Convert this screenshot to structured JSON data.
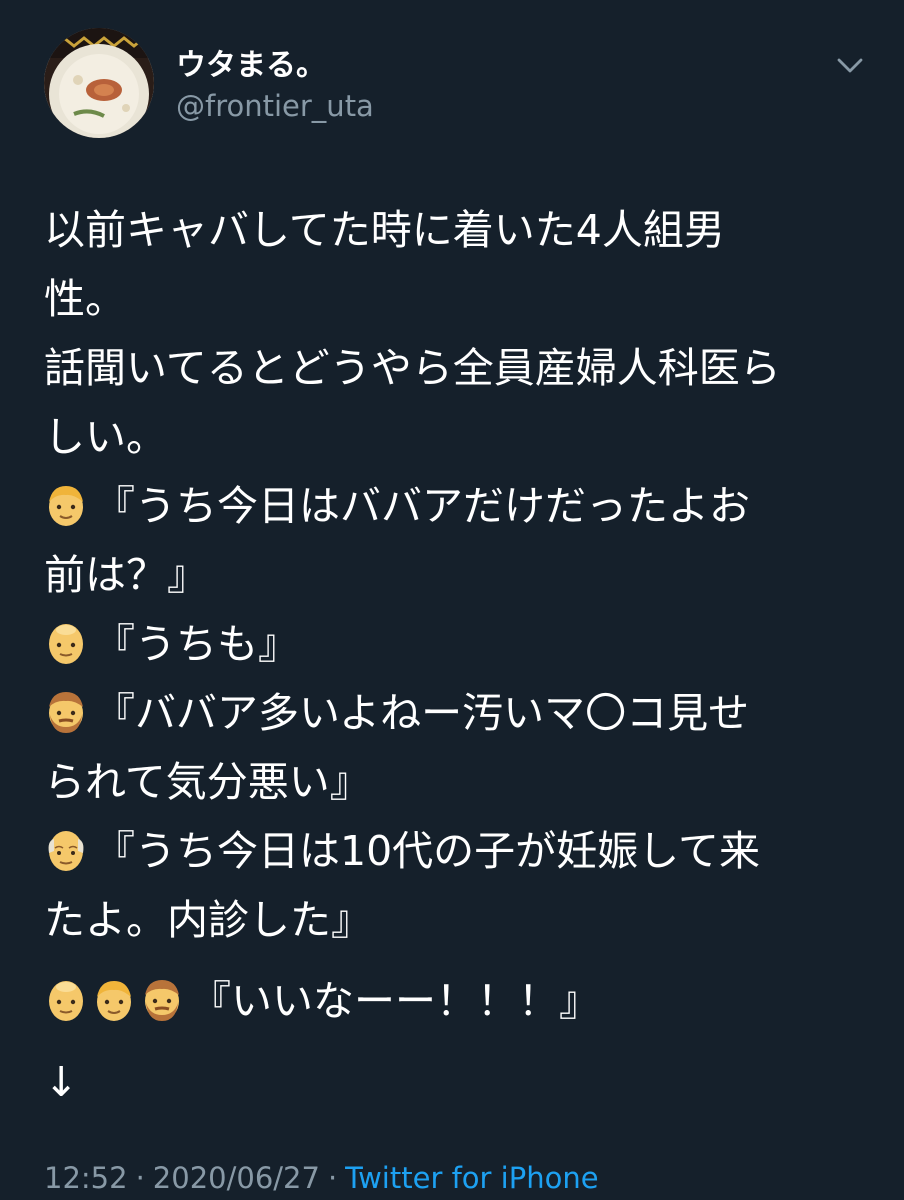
{
  "author": {
    "display_name": "ウタまる。",
    "handle": "@frontier_uta"
  },
  "icons": {
    "avatar": "ramen-bowl-avatar",
    "menu": "chevron-down-icon"
  },
  "tweet": {
    "lines": [
      "以前キャバしてた時に着いた4人組男",
      "性。",
      "話聞いてるとどうやら全員産婦人科医ら",
      "しい。",
      "『うち今日はババアだけだったよお",
      "前は？』",
      "『うちも』",
      "『ババア多いよねー汚いマ〇コ見せ",
      "られて気分悪い』",
      "『うち今日は10代の子が妊娠して来",
      "たよ。内診した』",
      "『いいなーー！！！』",
      "↓"
    ]
  },
  "meta": {
    "time": "12:52",
    "separator": "·",
    "date": "2020/06/27",
    "source": "Twitter for iPhone"
  },
  "colors": {
    "background": "#15202b",
    "text": "#ffffff",
    "secondary": "#8899a6",
    "link": "#1da1f2"
  }
}
